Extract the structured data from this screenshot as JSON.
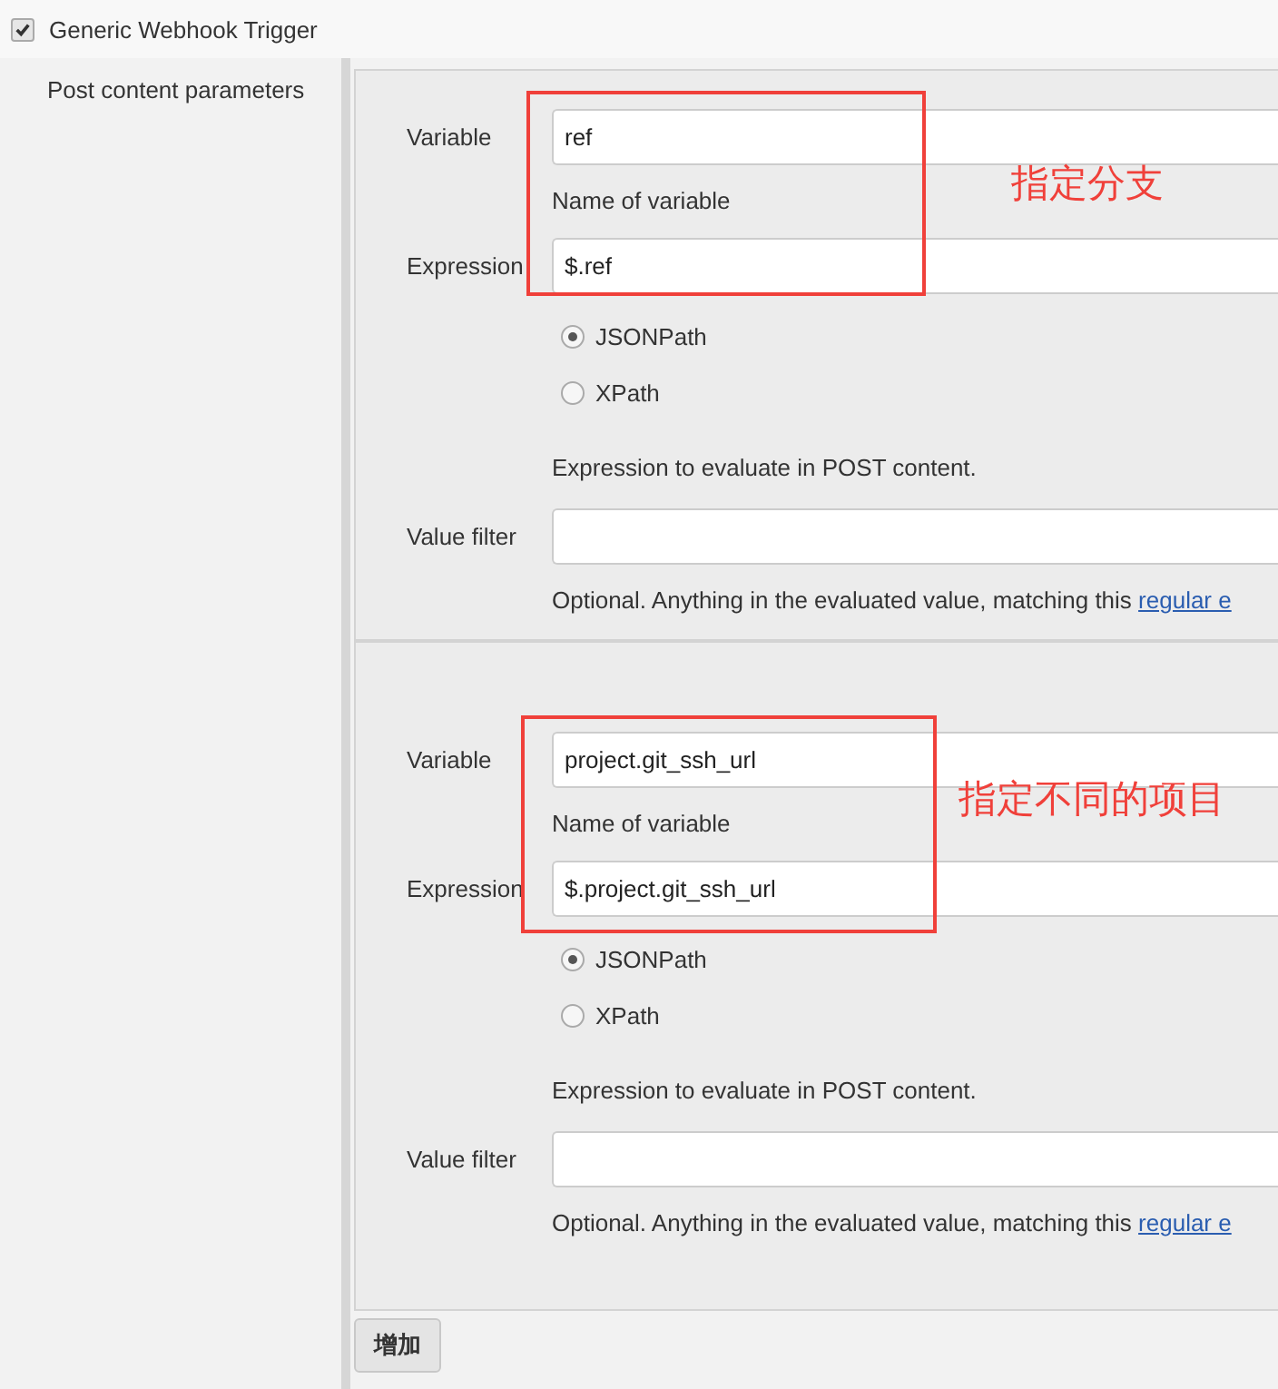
{
  "trigger": {
    "label": "Generic Webhook Trigger",
    "checked": true
  },
  "section": {
    "label": "Post content parameters"
  },
  "parameters": [
    {
      "variable_label": "Variable",
      "variable": "ref",
      "variable_help": "Name of variable",
      "expression_label": "Expression",
      "expression": "$.ref",
      "options": [
        {
          "label": "JSONPath",
          "selected": true
        },
        {
          "label": "XPath",
          "selected": false
        }
      ],
      "expression_help": "Expression to evaluate in POST content.",
      "filter_label": "Value filter",
      "filter_help": "Optional. Anything in the evaluated value, matching this ",
      "filter_link": "regular e",
      "annotation": "指定分支"
    },
    {
      "variable_label": "Variable",
      "variable": "project.git_ssh_url",
      "variable_help": "Name of variable",
      "expression_label": "Expression",
      "expression": "$.project.git_ssh_url",
      "options": [
        {
          "label": "JSONPath",
          "selected": true
        },
        {
          "label": "XPath",
          "selected": false
        }
      ],
      "expression_help": "Expression to evaluate in POST content.",
      "filter_label": "Value filter",
      "filter_help": "Optional. Anything in the evaluated value, matching this ",
      "filter_link": "regular e",
      "annotation": "指定不同的项目"
    }
  ],
  "add_button": "增加"
}
